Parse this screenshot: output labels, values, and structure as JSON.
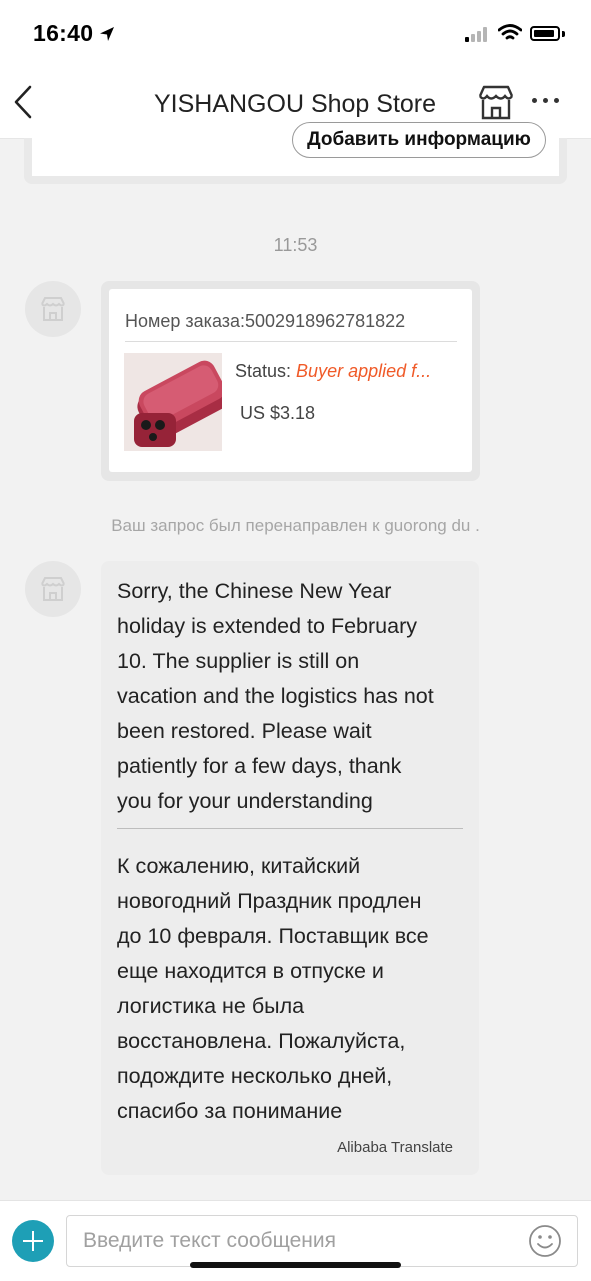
{
  "status_bar": {
    "time": "16:40",
    "icons": [
      "location-arrow-icon",
      "cellular-signal-icon",
      "wifi-icon",
      "battery-icon"
    ]
  },
  "nav": {
    "title": "YISHANGOU Shop Store",
    "icons": [
      "back-chevron-icon",
      "store-icon",
      "more-icon"
    ]
  },
  "top_card": {
    "button_label": "Добавить информацию"
  },
  "chat": {
    "timestamp": "11:53",
    "order_card": {
      "order_label": "Номер заказа:5002918962781822",
      "status_label": "Status:",
      "status_value": "Buyer applied f...",
      "price": "US $3.18",
      "status_color": "#f05a28"
    },
    "system_note": "Ваш запрос был перенаправлен к guorong du .",
    "message": {
      "lines_en": [
        "Sorry, the Chinese New Year",
        "holiday is extended to February",
        "10. The supplier is still on",
        "vacation and the logistics has not",
        "been restored. Please wait",
        "patiently for a few days, thank",
        "you for your understanding"
      ],
      "lines_ru": [
        "К сожалению, китайский",
        "новогодний Праздник продлен",
        "до 10 февраля. Поставщик все",
        "еще находится в отпуске и",
        "логистика не была",
        "восстановлена. Пожалуйста,",
        "подождите несколько дней,",
        "спасибо за понимание"
      ],
      "translation_credit": "Alibaba Translate"
    }
  },
  "input_bar": {
    "placeholder": "Введите текст сообщения",
    "accent_color": "#1e9fb6",
    "icons": [
      "add-icon",
      "emoji-icon"
    ]
  }
}
